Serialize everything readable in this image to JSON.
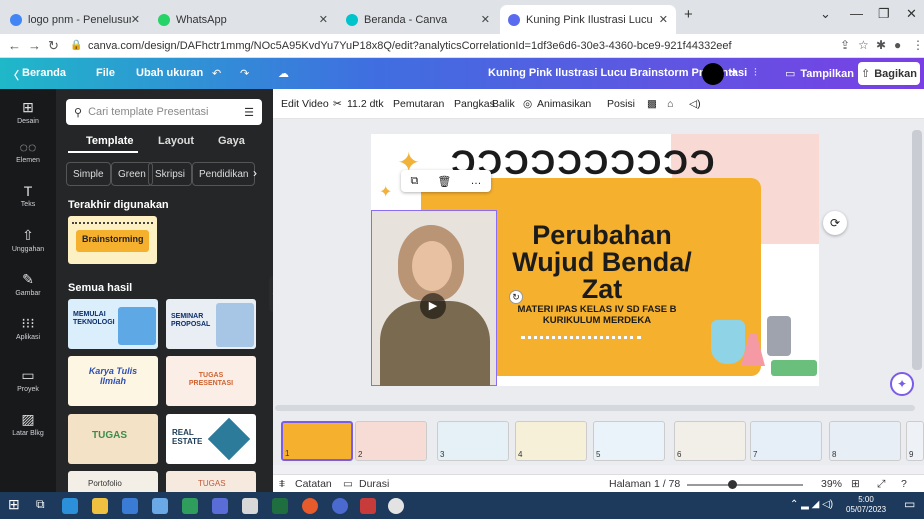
{
  "browser": {
    "tabs": [
      {
        "title": "logo pnm - Penelusuran Google",
        "color": "#4285f4"
      },
      {
        "title": "WhatsApp",
        "color": "#25d366"
      },
      {
        "title": "Beranda - Canva",
        "color": "#00c4cc"
      },
      {
        "title": "Kuning Pink Ilustrasi Lucu Brainst",
        "color": "#5b6bf0"
      }
    ],
    "new_tab": "+",
    "url": "canva.com/design/DAFhctr1mmg/NOc5A95KvdYu7YuP18x8Q/edit?analyticsCorrelationId=1df3e6d6-30e3-4360-bce9-921f44332eef"
  },
  "canva_header": {
    "home": "Beranda",
    "file": "File",
    "resize": "Ubah ukuran",
    "doc_title": "Kuning Pink Ilustrasi Lucu Brainstorm Presentasi",
    "present": "Tampilkan",
    "share": "Bagikan"
  },
  "rail": [
    {
      "label": "Desain",
      "icon": "layout-icon"
    },
    {
      "label": "Elemen",
      "icon": "shapes-icon"
    },
    {
      "label": "Teks",
      "icon": "text-icon"
    },
    {
      "label": "Unggahan",
      "icon": "upload-icon"
    },
    {
      "label": "Gambar",
      "icon": "draw-icon"
    },
    {
      "label": "Aplikasi",
      "icon": "apps-icon"
    },
    {
      "label": "Proyek",
      "icon": "folder-icon"
    },
    {
      "label": "Latar Blkg",
      "icon": "background-icon"
    }
  ],
  "panel": {
    "search_placeholder": "Cari template Presentasi",
    "tabs": [
      "Template",
      "Layout",
      "Gaya"
    ],
    "chips": [
      "Simple",
      "Green",
      "Skripsi",
      "Pendidikan"
    ],
    "recent_heading": "Terakhir digunakan",
    "recent_thumb": "Brainstorming",
    "all_heading": "Semua hasil",
    "templates": [
      {
        "title": "MEMULAI TEKNOLOGI",
        "bg": "#dbeefc",
        "fg": "#0b2d6b"
      },
      {
        "title": "SEMINAR PROPOSAL",
        "bg": "#e9eef5",
        "fg": "#0b2d6b"
      },
      {
        "title": "Karya Tulis Ilmiah",
        "bg": "#fdf6e3",
        "fg": "#2e4fb3"
      },
      {
        "title": "TUGAS PRESENTASI",
        "bg": "#fbeee6",
        "fg": "#d0622f"
      },
      {
        "title": "TUGAS",
        "bg": "#f3e2c6",
        "fg": "#3c8c4c"
      },
      {
        "title": "REAL ESTATE",
        "bg": "#ffffff",
        "fg": "#1c3b56"
      },
      {
        "title": "Portofolio",
        "bg": "#f4efe6",
        "fg": "#333333"
      },
      {
        "title": "TUGAS",
        "bg": "#f6e9dd",
        "fg": "#c25a3a"
      }
    ]
  },
  "toolbar": {
    "edit_video": "Edit Video",
    "duration": "11.2 dtk",
    "playback": "Pemutaran",
    "crop": "Pangkas",
    "flip": "Balik",
    "animate": "Animasikan",
    "position": "Posisi"
  },
  "slide": {
    "title_line1": "Perubahan",
    "title_line2": "Wujud Benda/",
    "title_line3": "Zat",
    "subtitle_line1": "MATERI IPAS KELAS IV SD FASE B",
    "subtitle_line2": "KURIKULUM MERDEKA",
    "accent": "#f5b02e"
  },
  "strip": {
    "pages": [
      "1",
      "2",
      "3",
      "4",
      "5",
      "6",
      "7",
      "8",
      "9"
    ]
  },
  "bottom": {
    "notes": "Catatan",
    "duration": "Durasi",
    "page": "Halaman 1 / 78",
    "zoom": "39%",
    "zoom_level": 0.39
  },
  "taskbar": {
    "time": "5:00",
    "date": "05/07/2023"
  }
}
